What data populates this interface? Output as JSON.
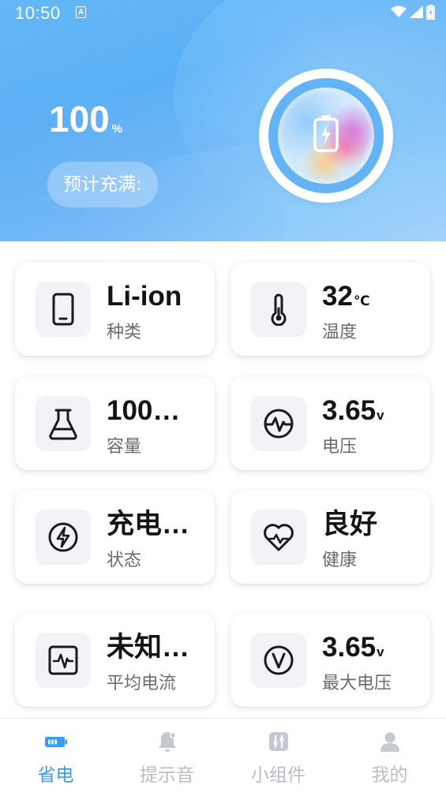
{
  "status_bar": {
    "time": "10:50",
    "notification_icon": "a-icon",
    "icons": [
      "wifi-icon",
      "signal-icon",
      "battery-charging-icon"
    ]
  },
  "battery": {
    "percent": "100",
    "unit": "%",
    "eta_label": "预计充满:",
    "orb_icon": "battery-charging-icon"
  },
  "cards": [
    {
      "id": "type",
      "icon": "phone-icon",
      "value": "Li-ion",
      "unit": "",
      "label": "种类"
    },
    {
      "id": "temperature",
      "icon": "thermometer-icon",
      "value": "32",
      "unit": "℃",
      "label": "温度"
    },
    {
      "id": "capacity",
      "icon": "flask-icon",
      "value": "100…",
      "unit": "",
      "label": "容量"
    },
    {
      "id": "voltage",
      "icon": "pulse-icon",
      "value": "3.65",
      "unit": "v",
      "label": "电压"
    },
    {
      "id": "status",
      "icon": "lightning-icon",
      "value": "充电…",
      "unit": "",
      "label": "状态"
    },
    {
      "id": "health",
      "icon": "heart-pulse-icon",
      "value": "良好",
      "unit": "",
      "label": "健康"
    },
    {
      "id": "avg-current",
      "icon": "monitor-pulse-icon",
      "value": "未知…",
      "unit": "",
      "label": "平均电流"
    },
    {
      "id": "max-voltage",
      "icon": "volt-circle-icon",
      "value": "3.65",
      "unit": "v",
      "label": "最大电压"
    }
  ],
  "nav": [
    {
      "label": "省电",
      "icon": "battery-icon",
      "active": true
    },
    {
      "label": "提示音",
      "icon": "bell-icon",
      "active": false
    },
    {
      "label": "小组件",
      "icon": "widget-sliders-icon",
      "active": false
    },
    {
      "label": "我的",
      "icon": "user-icon",
      "active": false
    }
  ],
  "colors": {
    "accent": "#3a9bf3",
    "nav_inactive": "#b8bcc4",
    "header_blue": "#5ab0f6"
  }
}
